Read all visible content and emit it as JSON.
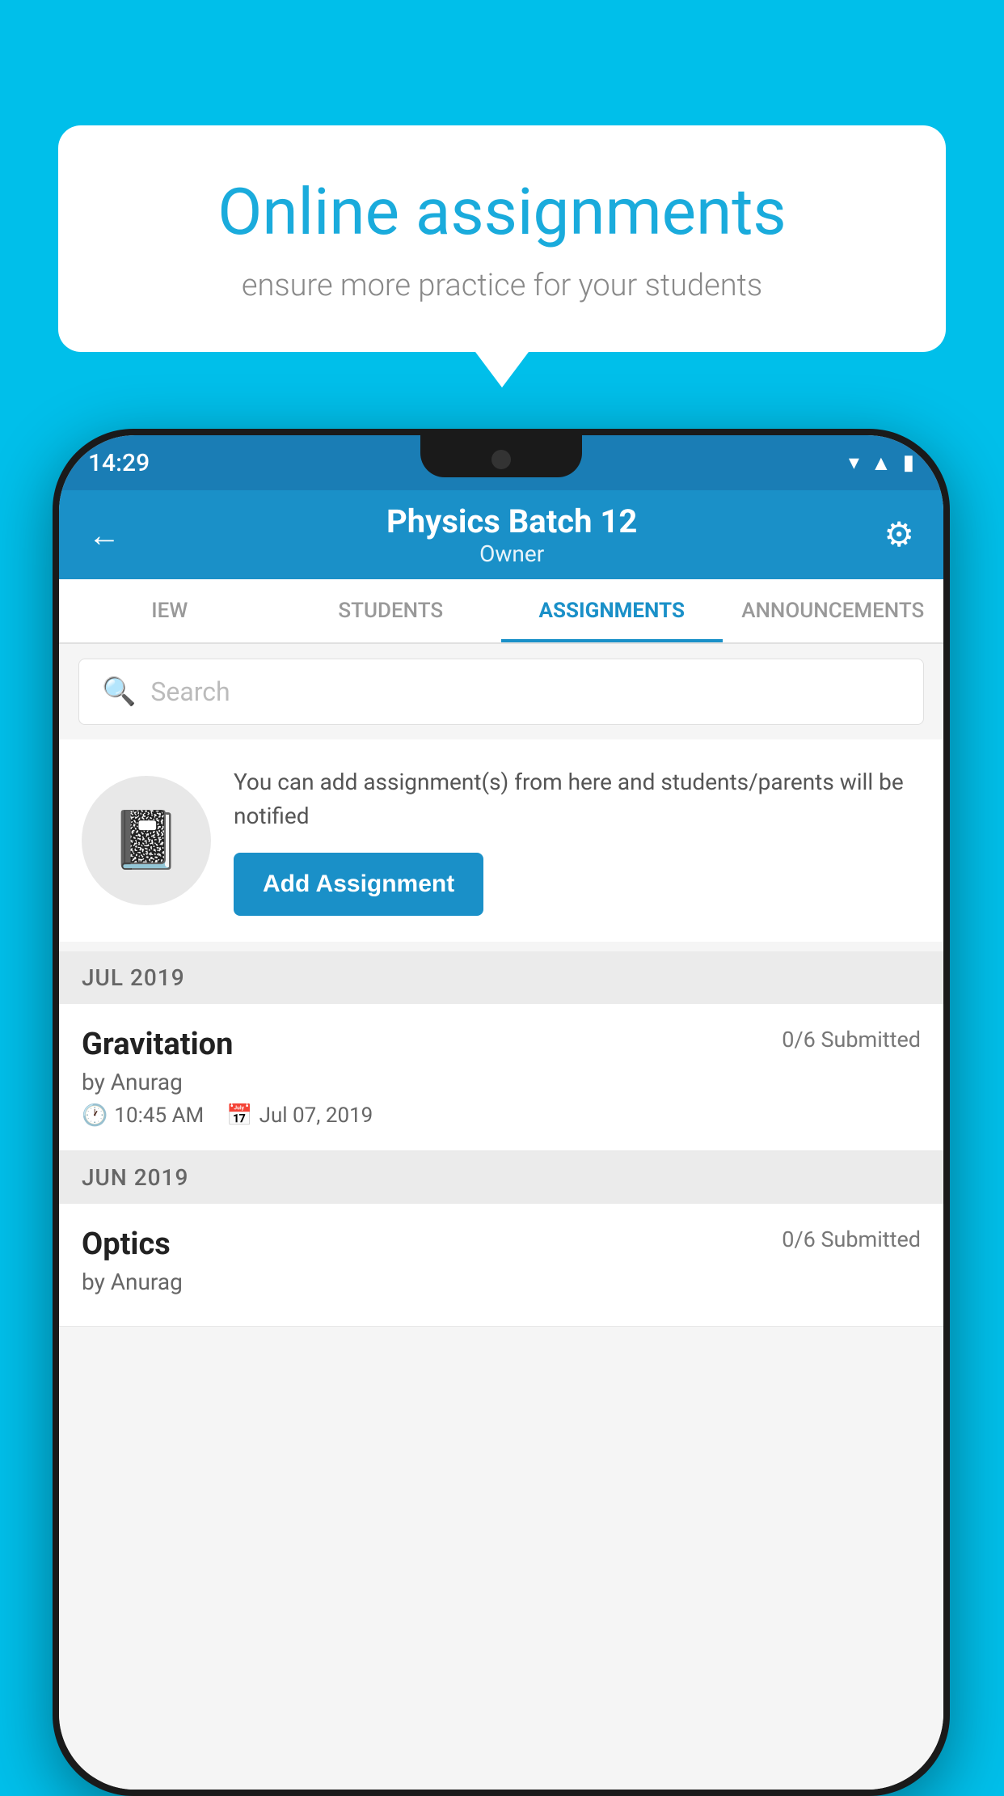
{
  "background_color": "#00BFEA",
  "speech_bubble": {
    "title": "Online assignments",
    "subtitle": "ensure more practice for your students"
  },
  "phone": {
    "status_bar": {
      "time": "14:29",
      "wifi_icon": "▾",
      "signal_icon": "▲",
      "battery_icon": "▮"
    },
    "header": {
      "title": "Physics Batch 12",
      "subtitle": "Owner",
      "back_label": "←",
      "settings_label": "⚙"
    },
    "tabs": [
      {
        "label": "IEW",
        "active": false
      },
      {
        "label": "STUDENTS",
        "active": false
      },
      {
        "label": "ASSIGNMENTS",
        "active": true
      },
      {
        "label": "ANNOUNCEMENTS",
        "active": false
      }
    ],
    "search": {
      "placeholder": "Search"
    },
    "promo": {
      "icon": "📓",
      "text": "You can add assignment(s) from here and students/parents will be notified",
      "button_label": "Add Assignment"
    },
    "sections": [
      {
        "month_label": "JUL 2019",
        "assignments": [
          {
            "name": "Gravitation",
            "submitted": "0/6 Submitted",
            "by": "by Anurag",
            "time": "10:45 AM",
            "date": "Jul 07, 2019"
          }
        ]
      },
      {
        "month_label": "JUN 2019",
        "assignments": [
          {
            "name": "Optics",
            "submitted": "0/6 Submitted",
            "by": "by Anurag",
            "time": "",
            "date": ""
          }
        ]
      }
    ]
  }
}
